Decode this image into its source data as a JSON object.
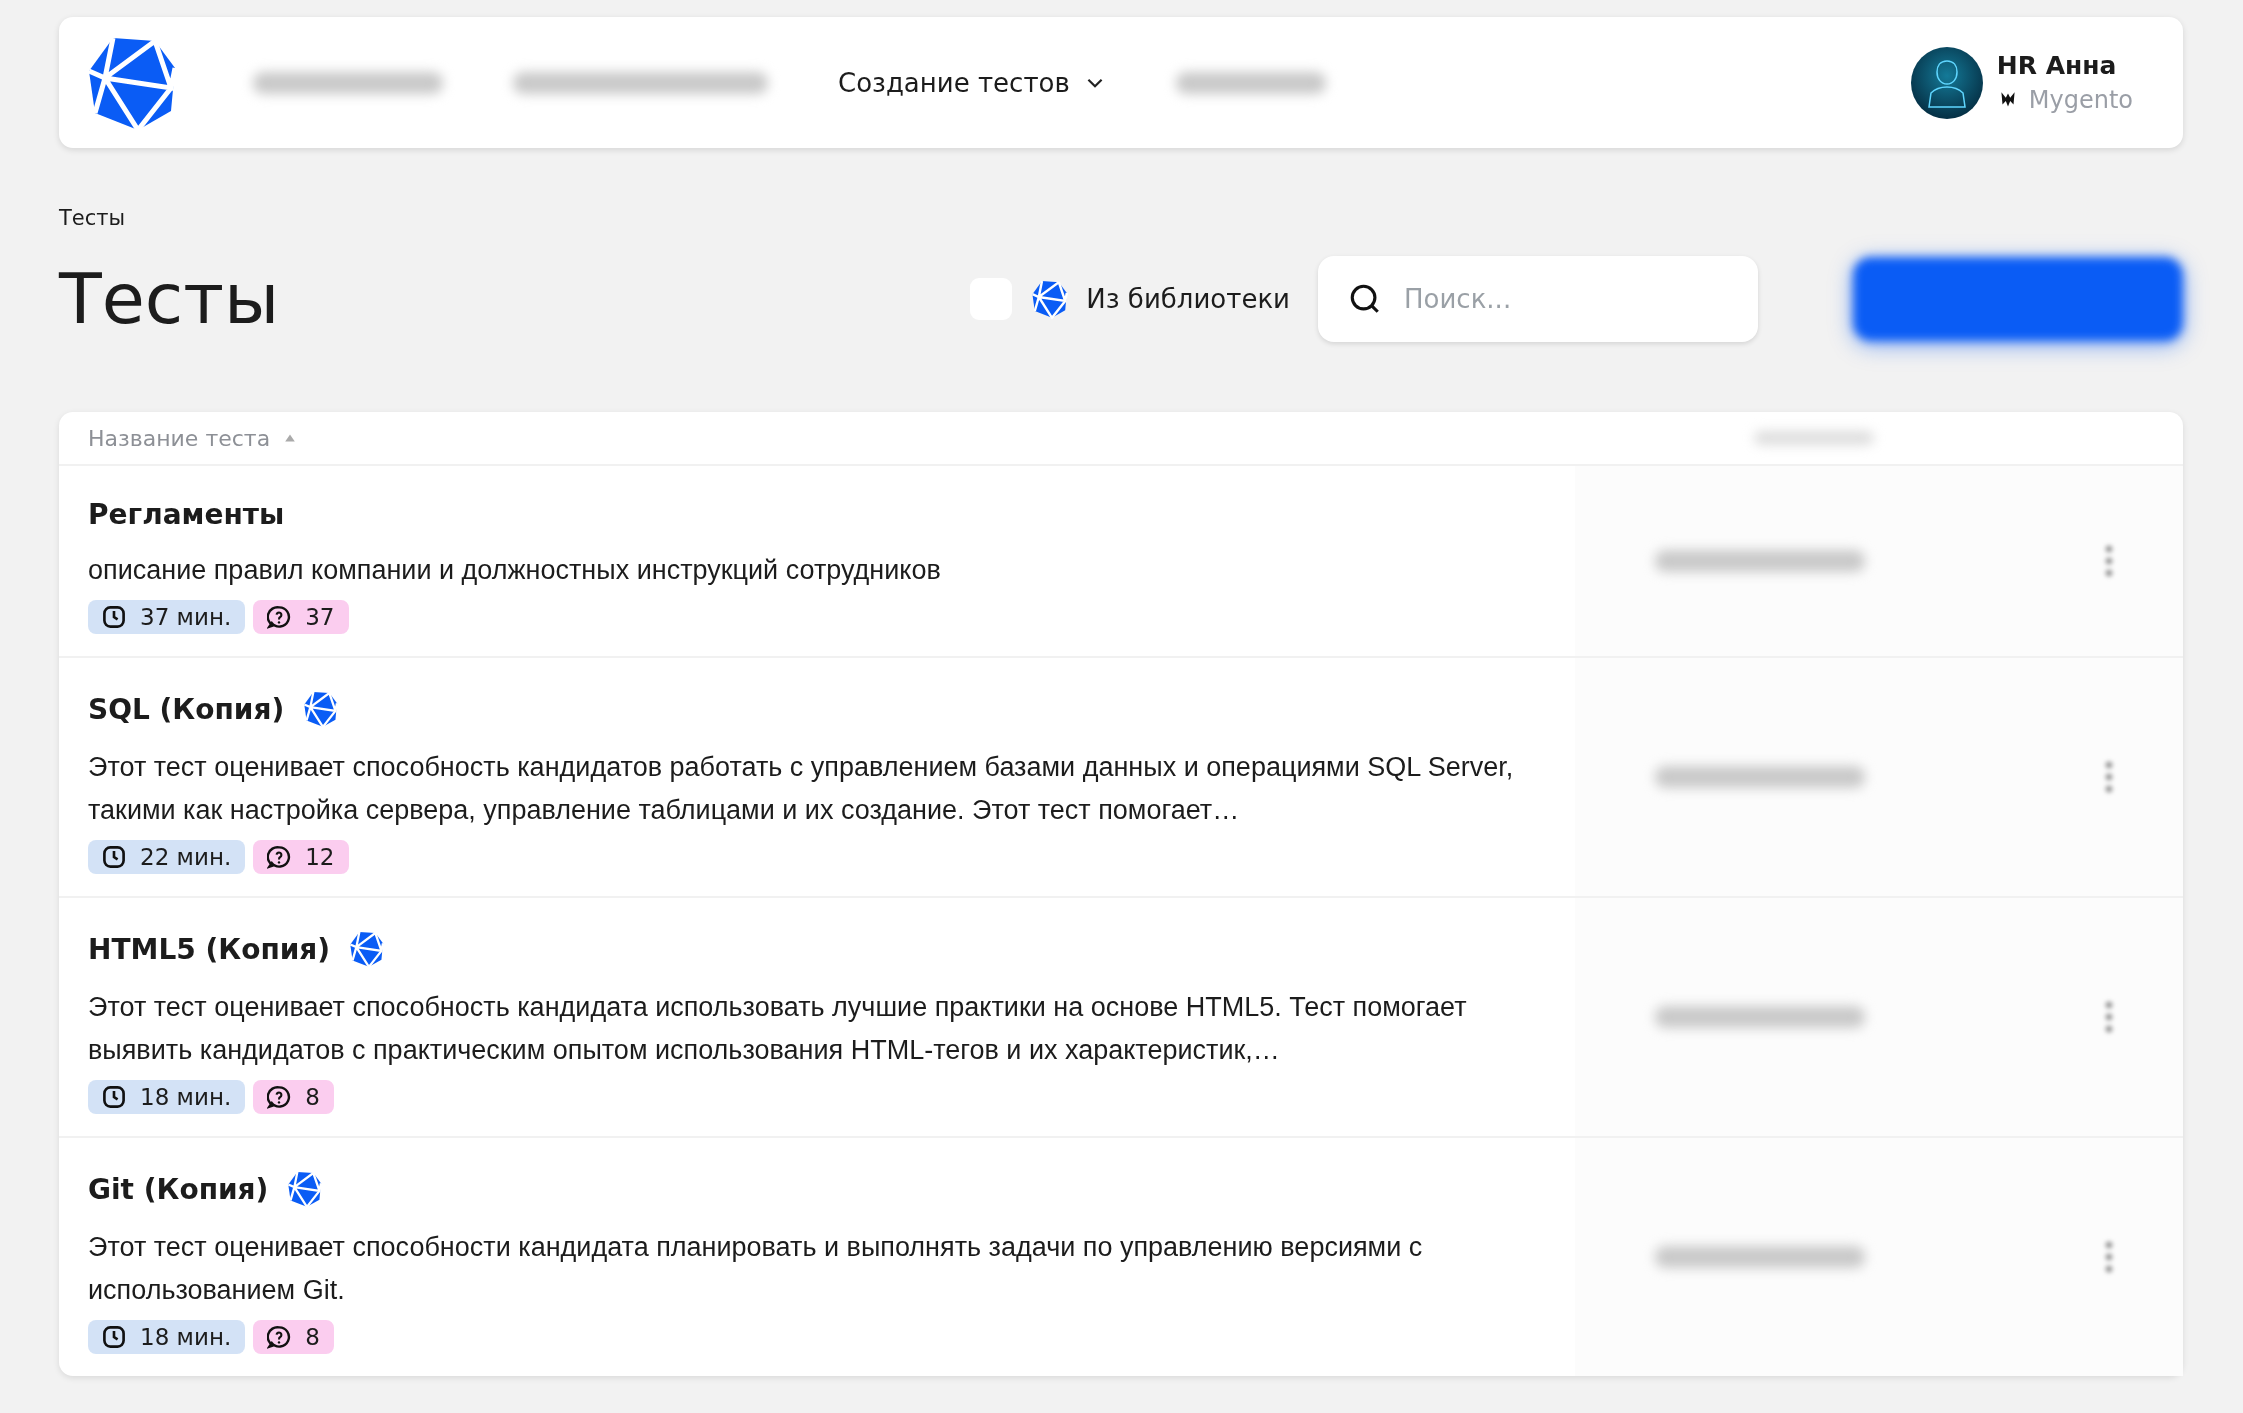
{
  "nav": {
    "items": [
      {
        "label": "Создание тестов",
        "has_menu": true
      }
    ]
  },
  "user": {
    "name": "HR Анна",
    "company": "Mygento"
  },
  "breadcrumb": "Тесты",
  "title": "Тесты",
  "library_filter": {
    "label": "Из библиотеки",
    "checked": false
  },
  "search": {
    "placeholder": "Поиск..."
  },
  "table": {
    "columns": [
      {
        "label": "Название теста",
        "sort_ascending": true
      }
    ],
    "rows": [
      {
        "title": "Регламенты",
        "from_library": false,
        "description": "описание правил компании и должностных инструкций сотрудников",
        "duration": "37 мин.",
        "questions": "37"
      },
      {
        "title": "SQL (Копия)",
        "from_library": true,
        "description": "Этот тест оценивает способность кандидатов работать с управлением базами данных и операциями SQL Server, такими как настройка сервера, управление таблицами и их создание. Этот тест помогает…",
        "duration": "22 мин.",
        "questions": "12"
      },
      {
        "title": "HTML5 (Копия)",
        "from_library": true,
        "description": "Этот тест оценивает способность кандидата использовать лучшие практики на основе HTML5. Тест помогает выявить кандидатов с практическим опытом использования HTML-тегов и их характеристик,…",
        "duration": "18 мин.",
        "questions": "8"
      },
      {
        "title": "Git (Копия)",
        "from_library": true,
        "description": "Этот тест оценивает способности кандидата планировать и выполнять задачи по управлению версиями с использованием Git.",
        "duration": "18 мин.",
        "questions": "8"
      }
    ]
  }
}
